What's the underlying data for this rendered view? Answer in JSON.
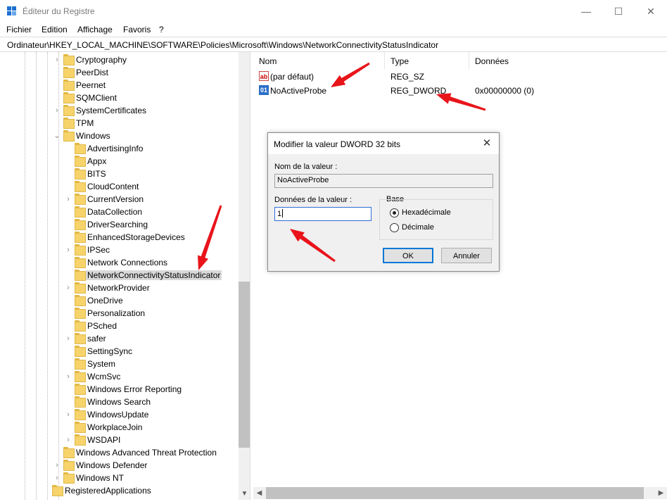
{
  "window": {
    "title": "Éditeur du Registre",
    "minimize": "—",
    "maximize": "☐",
    "close": "✕"
  },
  "menu": [
    "Fichier",
    "Edition",
    "Affichage",
    "Favoris",
    "?"
  ],
  "address": "Ordinateur\\HKEY_LOCAL_MACHINE\\SOFTWARE\\Policies\\Microsoft\\Windows\\NetworkConnectivityStatusIndicator",
  "tree": [
    {
      "label": "Cryptography",
      "level": 1,
      "expandable": true
    },
    {
      "label": "PeerDist",
      "level": 1,
      "expandable": false
    },
    {
      "label": "Peernet",
      "level": 1,
      "expandable": false
    },
    {
      "label": "SQMClient",
      "level": 1,
      "expandable": false
    },
    {
      "label": "SystemCertificates",
      "level": 1,
      "expandable": true
    },
    {
      "label": "TPM",
      "level": 1,
      "expandable": false
    },
    {
      "label": "Windows",
      "level": 1,
      "expandable": true,
      "expanded": true
    },
    {
      "label": "AdvertisingInfo",
      "level": 2,
      "expandable": false
    },
    {
      "label": "Appx",
      "level": 2,
      "expandable": false
    },
    {
      "label": "BITS",
      "level": 2,
      "expandable": false
    },
    {
      "label": "CloudContent",
      "level": 2,
      "expandable": false
    },
    {
      "label": "CurrentVersion",
      "level": 2,
      "expandable": true
    },
    {
      "label": "DataCollection",
      "level": 2,
      "expandable": false
    },
    {
      "label": "DriverSearching",
      "level": 2,
      "expandable": false
    },
    {
      "label": "EnhancedStorageDevices",
      "level": 2,
      "expandable": false
    },
    {
      "label": "IPSec",
      "level": 2,
      "expandable": true
    },
    {
      "label": "Network Connections",
      "level": 2,
      "expandable": false
    },
    {
      "label": "NetworkConnectivityStatusIndicator",
      "level": 2,
      "expandable": false,
      "selected": true
    },
    {
      "label": "NetworkProvider",
      "level": 2,
      "expandable": true
    },
    {
      "label": "OneDrive",
      "level": 2,
      "expandable": false
    },
    {
      "label": "Personalization",
      "level": 2,
      "expandable": false
    },
    {
      "label": "PSched",
      "level": 2,
      "expandable": false
    },
    {
      "label": "safer",
      "level": 2,
      "expandable": true
    },
    {
      "label": "SettingSync",
      "level": 2,
      "expandable": false
    },
    {
      "label": "System",
      "level": 2,
      "expandable": false
    },
    {
      "label": "WcmSvc",
      "level": 2,
      "expandable": true
    },
    {
      "label": "Windows Error Reporting",
      "level": 2,
      "expandable": false
    },
    {
      "label": "Windows Search",
      "level": 2,
      "expandable": false
    },
    {
      "label": "WindowsUpdate",
      "level": 2,
      "expandable": true
    },
    {
      "label": "WorkplaceJoin",
      "level": 2,
      "expandable": false
    },
    {
      "label": "WSDAPI",
      "level": 2,
      "expandable": true
    },
    {
      "label": "Windows Advanced Threat Protection",
      "level": 1,
      "expandable": false
    },
    {
      "label": "Windows Defender",
      "level": 1,
      "expandable": true
    },
    {
      "label": "Windows NT",
      "level": 1,
      "expandable": true
    },
    {
      "label": "RegisteredApplications",
      "level": 0,
      "expandable": false
    }
  ],
  "columns": {
    "name": "Nom",
    "type": "Type",
    "data": "Données"
  },
  "values": [
    {
      "icon": "string-value-icon",
      "glyph": "ab",
      "name": "(par défaut)",
      "type": "REG_SZ",
      "data": ""
    },
    {
      "icon": "binary-value-icon",
      "glyph": "01",
      "name": "NoActiveProbe",
      "type": "REG_DWORD",
      "data": "0x00000000 (0)"
    }
  ],
  "dialog": {
    "title": "Modifier la valeur DWORD 32 bits",
    "close": "✕",
    "name_label": "Nom de la valeur :",
    "name_value": "NoActiveProbe",
    "data_label": "Données de la valeur :",
    "data_value": "1",
    "base_label": "Base",
    "radio_hex": "Hexadécimale",
    "radio_dec": "Décimale",
    "base_selected": "hex",
    "ok": "OK",
    "cancel": "Annuler"
  },
  "colors": {
    "annotation_arrow": "#e8141a",
    "selection": "#d9d9d9",
    "folder": "#f7d36b"
  }
}
